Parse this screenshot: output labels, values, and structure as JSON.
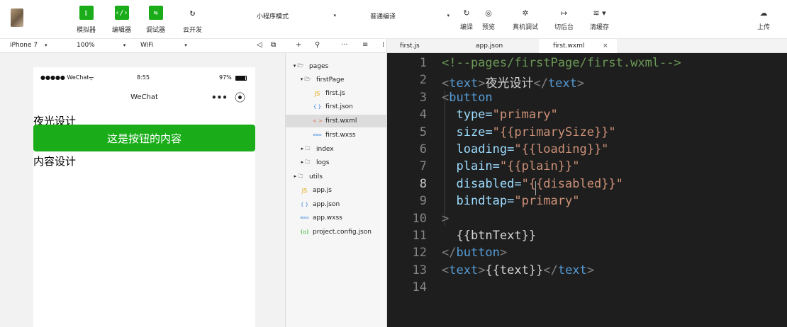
{
  "toolbar": {
    "mode_select": "小程序模式",
    "compile_select": "普通编译",
    "buttons": [
      {
        "label": "模拟器",
        "icon": "simulator-icon",
        "glyph": "▯"
      },
      {
        "label": "编辑器",
        "icon": "editor-icon",
        "glyph": "‹/›"
      },
      {
        "label": "调试器",
        "icon": "debugger-icon",
        "glyph": "⇆"
      },
      {
        "label": "云开发",
        "icon": "cloud-dev-icon",
        "glyph": "↻"
      }
    ],
    "right": [
      {
        "label": "编译",
        "icon": "compile-icon",
        "glyph": "↻"
      },
      {
        "label": "预览",
        "icon": "preview-icon",
        "glyph": "◎"
      },
      {
        "label": "真机调试",
        "icon": "device-debug-icon",
        "glyph": "✲"
      },
      {
        "label": "切后台",
        "icon": "background-icon",
        "glyph": "↦"
      },
      {
        "label": "清缓存",
        "icon": "clear-cache-icon",
        "glyph": "≋ ▾"
      },
      {
        "label": "上传",
        "icon": "upload-icon",
        "glyph": "☁"
      }
    ]
  },
  "simulator": {
    "device": "iPhone 7",
    "zoom": "100%",
    "network": "WiFi",
    "status": {
      "carrier": "●●●●● WeChat",
      "wifi": "ᯤ",
      "time": "8:55",
      "battery": "97%"
    },
    "nav_title": "WeChat",
    "nav_more": "•••",
    "nav_home": "⦿",
    "text1": "夜光设计",
    "button_label": "这是按钮的内容",
    "text2": "内容设计",
    "colors": {
      "primary_button": "#1aad19"
    }
  },
  "filetree": {
    "items": [
      {
        "label": "pages",
        "icon": "folder-icon",
        "glyph": "▾ 🗁"
      },
      {
        "label": "firstPage",
        "icon": "folder-icon",
        "glyph": "▾ 🗁"
      },
      {
        "label": "first.js",
        "icon": "js-file-icon",
        "glyph": "JS"
      },
      {
        "label": "first.json",
        "icon": "json-file-icon",
        "glyph": "{ }"
      },
      {
        "label": "first.wxml",
        "icon": "wxml-file-icon",
        "glyph": "< >"
      },
      {
        "label": "first.wxss",
        "icon": "wxss-file-icon",
        "glyph": "wxss"
      },
      {
        "label": "index",
        "icon": "folder-icon",
        "glyph": "▸ 🗀"
      },
      {
        "label": "logs",
        "icon": "folder-icon",
        "glyph": "▸ 🗀"
      },
      {
        "label": "utils",
        "icon": "folder-icon",
        "glyph": "▸ 🗀"
      },
      {
        "label": "app.js",
        "icon": "js-file-icon",
        "glyph": "JS"
      },
      {
        "label": "app.json",
        "icon": "json-file-icon",
        "glyph": "{ }"
      },
      {
        "label": "app.wxss",
        "icon": "wxss-file-icon",
        "glyph": "wxss"
      },
      {
        "label": "project.config.json",
        "icon": "config-file-icon",
        "glyph": "{o}"
      }
    ]
  },
  "tabs": [
    {
      "label": "first.js"
    },
    {
      "label": "app.json"
    },
    {
      "label": "first.wxml"
    }
  ],
  "tab_close": "×",
  "editor": {
    "current_line": 8,
    "line_numbers": [
      "1",
      "2",
      "3",
      "4",
      "5",
      "6",
      "7",
      "8",
      "9",
      "10",
      "11",
      "12",
      "13",
      "14"
    ],
    "lines": [
      [
        [
          "<!--pages/firstPage/first.wxml-->",
          "com"
        ]
      ],
      [
        [
          "<",
          "brk"
        ],
        [
          "text",
          "tag"
        ],
        [
          ">",
          "brk"
        ],
        [
          "夜光设计",
          "txt"
        ],
        [
          "</",
          "brk"
        ],
        [
          "text",
          "tag"
        ],
        [
          ">",
          "brk"
        ]
      ],
      [
        [
          "<",
          "brk"
        ],
        [
          "button",
          "tag"
        ]
      ],
      [
        [
          "  type=",
          "attr"
        ],
        [
          "\"primary\"",
          "str"
        ]
      ],
      [
        [
          "  size=",
          "attr"
        ],
        [
          "\"{{primarySize}}\"",
          "str"
        ]
      ],
      [
        [
          "  loading=",
          "attr"
        ],
        [
          "\"{{loading}}\"",
          "str"
        ]
      ],
      [
        [
          "  plain=",
          "attr"
        ],
        [
          "\"{{plain}}\"",
          "str"
        ]
      ],
      [
        [
          "  disabled=",
          "attr"
        ],
        [
          "\"{{disabled}}\"",
          "str"
        ]
      ],
      [
        [
          "  bindtap=",
          "attr"
        ],
        [
          "\"primary\"",
          "str"
        ]
      ],
      [
        [
          ">",
          "brk"
        ]
      ],
      [
        [
          "  {{btnText}}",
          "txt"
        ]
      ],
      [
        [
          "</",
          "brk"
        ],
        [
          "button",
          "tag"
        ],
        [
          ">",
          "brk"
        ]
      ],
      [
        [
          "<",
          "brk"
        ],
        [
          "text",
          "tag"
        ],
        [
          ">",
          "brk"
        ],
        [
          "{{text}}",
          "txt"
        ],
        [
          "</",
          "brk"
        ],
        [
          "text",
          "tag"
        ],
        [
          ">",
          "brk"
        ]
      ],
      []
    ]
  }
}
